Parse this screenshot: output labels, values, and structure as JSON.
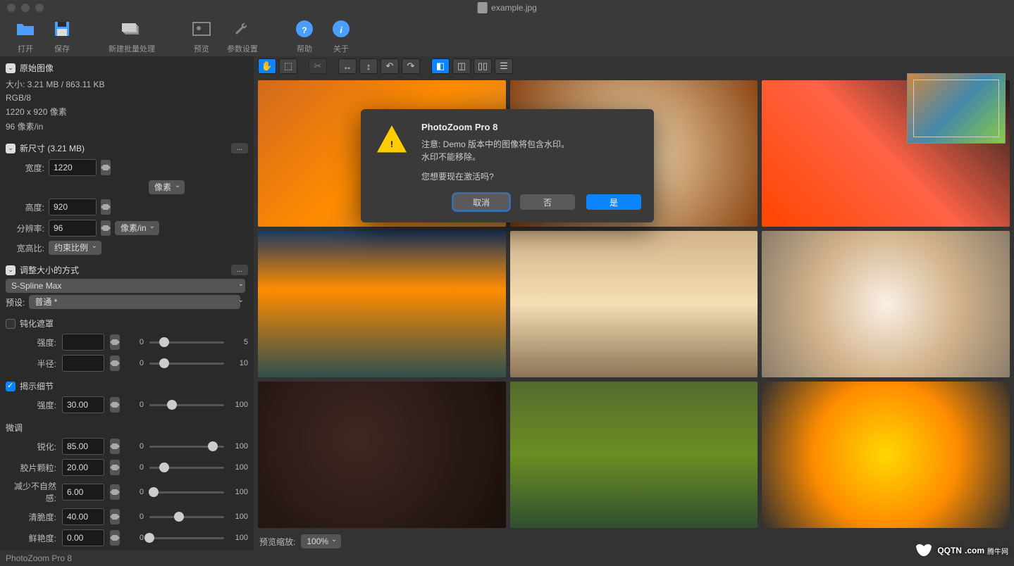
{
  "titlebar": {
    "filename": "example.jpg"
  },
  "toolbar": {
    "open": "打开",
    "save": "保存",
    "batch": "新建批量处理",
    "preview": "预览",
    "settings": "参数设置",
    "help": "帮助",
    "about": "关于"
  },
  "sidebar": {
    "original": {
      "header": "原始图像",
      "size": "大小: 3.21 MB / 863.11 KB",
      "mode": "RGB/8",
      "dims": "1220 x 920 像素",
      "dpi": "96 像素/in"
    },
    "newsize": {
      "header": "新尺寸 (3.21 MB)",
      "width_label": "宽度:",
      "width": "1220",
      "height_label": "高度:",
      "height": "920",
      "unit": "像素",
      "res_label": "分辨率:",
      "res": "96",
      "res_unit": "像素/in",
      "ratio_label": "宽高比:",
      "ratio": "约束比例"
    },
    "resize": {
      "header": "调整大小的方式",
      "method": "S-Spline Max",
      "preset_label": "预设:",
      "preset": "普通 *",
      "unsharp": "钝化遮罩",
      "intensity_label": "强度:",
      "intensity_min": "0",
      "intensity_max": "5",
      "radius_label": "半径:",
      "radius_min": "0",
      "radius_max": "10",
      "detail": "揭示细节",
      "detail_intensity": "30.00",
      "detail_min": "0",
      "detail_max": "100",
      "finetune": "微调",
      "sharp_label": "锐化:",
      "sharp": "85.00",
      "grain_label": "胶片颗粒:",
      "grain": "20.00",
      "unnatural_label": "减少不自然感:",
      "unnatural": "6.00",
      "crisp_label": "清脆度:",
      "crisp": "40.00",
      "vivid_label": "鲜艳度:",
      "vivid": "0.00",
      "s_min": "0",
      "s_max": "100"
    }
  },
  "preview": {
    "zoom_label": "预览缩放:",
    "zoom": "100%"
  },
  "dialog": {
    "title": "PhotoZoom Pro 8",
    "line1": "注意: Demo 版本中的图像将包含水印。",
    "line2": "水印不能移除。",
    "line3": "您想要现在激活吗?",
    "cancel": "取消",
    "no": "否",
    "yes": "是"
  },
  "statusbar": {
    "app": "PhotoZoom Pro 8"
  },
  "watermark": {
    "brand": "QQTN",
    "suffix": ".com",
    "cn": "腾牛网"
  }
}
